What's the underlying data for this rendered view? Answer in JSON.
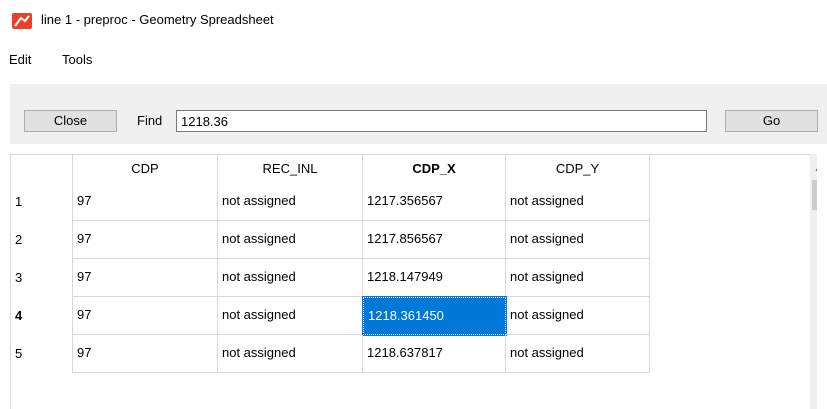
{
  "window": {
    "title": "line 1 - preproc - Geometry Spreadsheet",
    "icon": "app-logo-icon",
    "icon_color": "#e8402a"
  },
  "menu": {
    "items": [
      "Edit",
      "Tools"
    ]
  },
  "toolbar": {
    "close_label": "Close",
    "find_label": "Find",
    "find_value": "1218.36",
    "go_label": "Go"
  },
  "table": {
    "columns": [
      "CDP",
      "REC_INL",
      "CDP_X",
      "CDP_Y"
    ],
    "bold_column": "CDP_X",
    "rows": [
      {
        "num": "1",
        "cells": [
          "97",
          "not assigned",
          "1217.356567",
          "not assigned"
        ]
      },
      {
        "num": "2",
        "cells": [
          "97",
          "not assigned",
          "1217.856567",
          "not assigned"
        ]
      },
      {
        "num": "3",
        "cells": [
          "97",
          "not assigned",
          "1218.147949",
          "not assigned"
        ]
      },
      {
        "num": "4",
        "cells": [
          "97",
          "not assigned",
          "1218.361450",
          "not assigned"
        ]
      },
      {
        "num": "5",
        "cells": [
          "97",
          "not assigned",
          "1218.637817",
          "not assigned"
        ]
      }
    ],
    "selected_row": "4",
    "selected_column": "CDP_X",
    "selection_color": "#0078d7"
  },
  "scrollbar": {
    "up_arrow_icon": "chevron-up-icon"
  }
}
